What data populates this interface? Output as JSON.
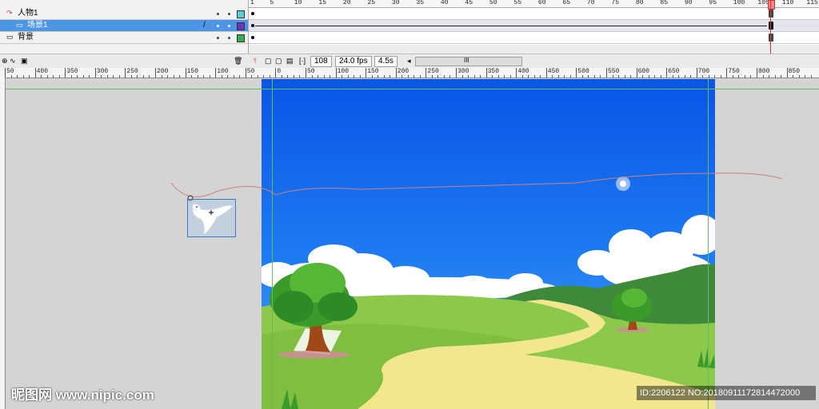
{
  "timeline": {
    "layers": [
      {
        "name": "人物1",
        "selected": false,
        "color": "#55d0d8",
        "icon": "motion-guide-icon"
      },
      {
        "name": "场景1",
        "selected": true,
        "color": "#7030c0",
        "icon": "layer-icon",
        "pencil": "/"
      },
      {
        "name": "背景",
        "selected": false,
        "color": "#30b050",
        "icon": "layer-icon"
      }
    ],
    "frame_ruler": [
      "1",
      "5",
      "10",
      "15",
      "20",
      "25",
      "30",
      "35",
      "40",
      "45",
      "50",
      "55",
      "60",
      "65",
      "70",
      "75",
      "80",
      "85",
      "90",
      "95",
      "100",
      "105",
      "110",
      "115"
    ],
    "current_frame": "108",
    "frame_rate": "24.0 fps",
    "elapsed_time": "4.5s",
    "scroll_grip": "III"
  },
  "stage_ruler": {
    "labels": [
      "50",
      "400",
      "350",
      "300",
      "250",
      "200",
      "150",
      "100",
      "50",
      "0",
      "50",
      "100",
      "150",
      "200",
      "250",
      "300",
      "350",
      "400",
      "450",
      "500",
      "550",
      "600",
      "650",
      "700",
      "750",
      "800",
      "850"
    ]
  },
  "watermark": "昵图网 www.nipic.com",
  "image_id": "ID:2206122 NO:20180911172814472000",
  "colors": {
    "sky_top": "#0a55e6",
    "sky_bottom": "#53a8f8",
    "hill_green": "#8cc84a",
    "path_yellow": "#f2e68e",
    "tree_green": "#3a9a2a",
    "motion_path": "#d08080"
  }
}
